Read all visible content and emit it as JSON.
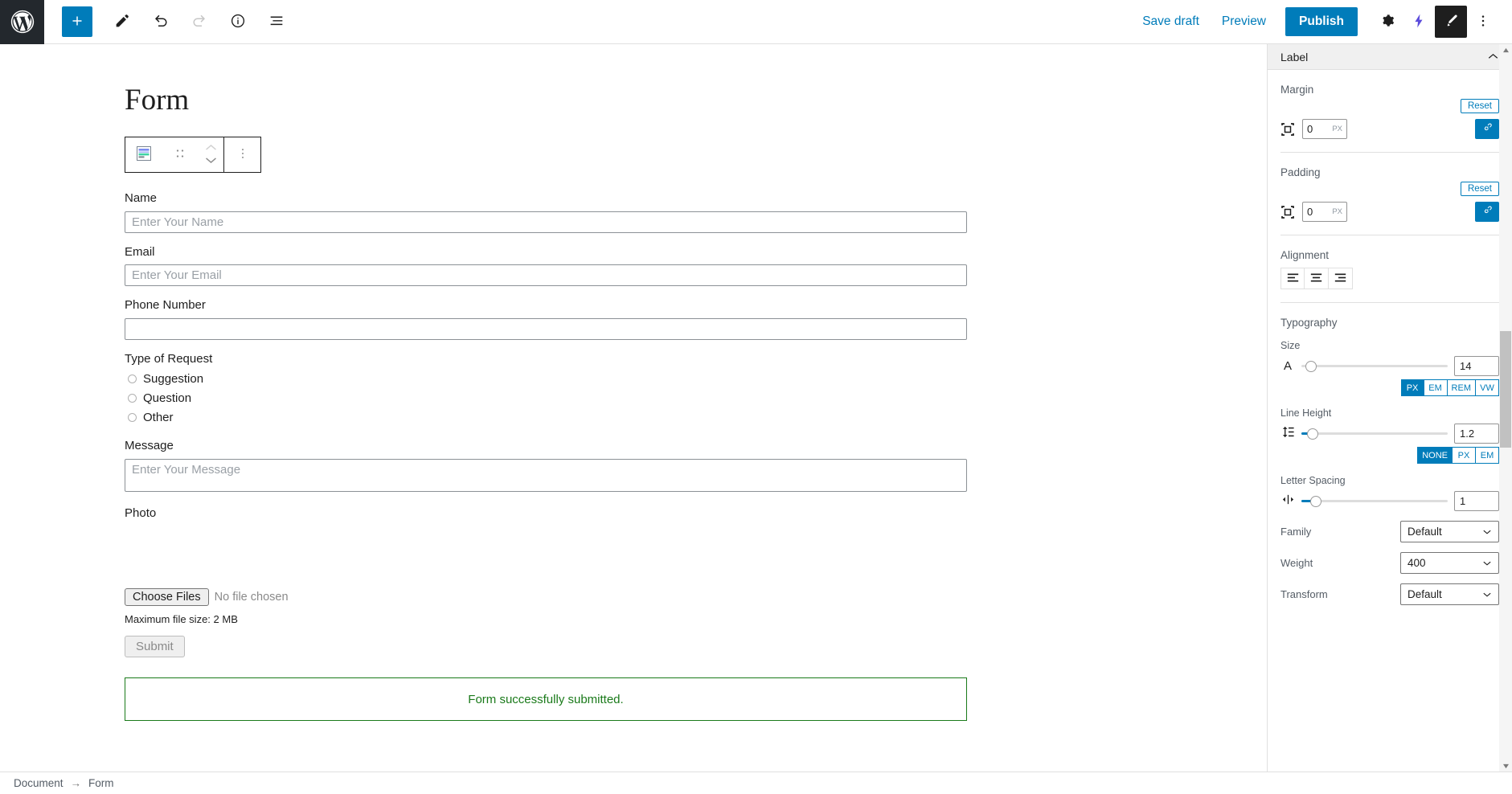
{
  "app": {
    "name": "WordPress Block Editor"
  },
  "topbar": {
    "logo_icon": "wordpress-logo-icon",
    "left_tools": [
      {
        "name": "add-block-button",
        "icon": "plus-icon",
        "label": "Add block"
      },
      {
        "name": "edit-tool-button",
        "icon": "pencil-icon",
        "label": "Tools"
      },
      {
        "name": "undo-button",
        "icon": "undo-arrow-icon",
        "label": "Undo"
      },
      {
        "name": "redo-button",
        "icon": "redo-arrow-icon",
        "label": "Redo"
      },
      {
        "name": "details-button",
        "icon": "info-circle-icon",
        "label": "Details"
      },
      {
        "name": "list-view-button",
        "icon": "list-view-icon",
        "label": "List view"
      }
    ],
    "save_draft_label": "Save draft",
    "preview_label": "Preview",
    "publish_label": "Publish",
    "right_tools": [
      {
        "name": "settings-button",
        "icon": "gear-icon",
        "label": "Settings"
      },
      {
        "name": "jetpack-button",
        "icon": "lightning-bolt-icon",
        "label": "Jetpack"
      },
      {
        "name": "styles-button",
        "icon": "paintbrush-icon",
        "label": "Styles"
      },
      {
        "name": "more-options-button",
        "icon": "vertical-ellipsis-icon",
        "label": "Options"
      }
    ]
  },
  "editor": {
    "post_title": "Form",
    "block_toolbar": {
      "block_type_icon": "form-block-icon",
      "drag_handle_icon": "drag-dots-icon",
      "move_up_icon": "chevron-up-icon",
      "move_down_icon": "chevron-down-icon",
      "more_icon": "vertical-ellipsis-icon"
    },
    "form": {
      "fields": [
        {
          "label": "Name",
          "type": "text",
          "value": "",
          "placeholder": "Enter Your Name"
        },
        {
          "label": "Email",
          "type": "text",
          "value": "",
          "placeholder": "Enter Your Email"
        },
        {
          "label": "Phone Number",
          "type": "text",
          "value": "",
          "placeholder": ""
        }
      ],
      "radio_group": {
        "label": "Type of Request",
        "options": [
          "Suggestion",
          "Question",
          "Other"
        ],
        "selected": ""
      },
      "message": {
        "label": "Message",
        "value": "",
        "placeholder": "Enter Your Message"
      },
      "photo": {
        "label": "Photo",
        "choose_files_label": "Choose Files",
        "no_file_text": "No file chosen",
        "max_size_text": "Maximum file size: 2 MB"
      },
      "submit_label": "Submit",
      "success_message": "Form successfully submitted.",
      "success_color": "#1a7a1a"
    }
  },
  "sidebar": {
    "panel_title": "Label",
    "collapse_icon": "chevron-up-icon",
    "margin": {
      "title": "Margin",
      "reset_label": "Reset",
      "box_icon": "spacing-box-icon",
      "value": "0",
      "unit": "PX",
      "link_icon": "link-icon"
    },
    "padding": {
      "title": "Padding",
      "reset_label": "Reset",
      "box_icon": "spacing-box-icon",
      "value": "0",
      "unit": "PX",
      "link_icon": "link-icon"
    },
    "alignment": {
      "title": "Alignment",
      "options": [
        {
          "name": "align-left-button",
          "icon": "align-left-icon"
        },
        {
          "name": "align-center-button",
          "icon": "align-center-icon"
        },
        {
          "name": "align-right-button",
          "icon": "align-right-icon"
        }
      ]
    },
    "typography": {
      "title": "Typography",
      "size": {
        "label": "Size",
        "icon": "letter-a-icon",
        "value": "14",
        "slider_percent": 3,
        "units": [
          "PX",
          "EM",
          "REM",
          "VW"
        ],
        "active_unit": "PX"
      },
      "line_height": {
        "label": "Line Height",
        "icon": "line-height-icon",
        "value": "1.2",
        "slider_percent": 6,
        "units": [
          "NONE",
          "PX",
          "EM"
        ],
        "active_unit": "NONE"
      },
      "letter_spacing": {
        "label": "Letter Spacing",
        "icon": "letter-spacing-icon",
        "value": "1",
        "slider_percent": 8
      },
      "family": {
        "label": "Family",
        "value": "Default"
      },
      "weight": {
        "label": "Weight",
        "value": "400"
      },
      "transform": {
        "label": "Transform",
        "value": "Default"
      }
    }
  },
  "bottombar": {
    "breadcrumb": [
      "Document",
      "Form"
    ],
    "separator": "→"
  },
  "colors": {
    "accent": "#007cba",
    "dark": "#1e1e1e",
    "success": "#1a7a1a",
    "panel_bg": "#f0f0f0"
  }
}
